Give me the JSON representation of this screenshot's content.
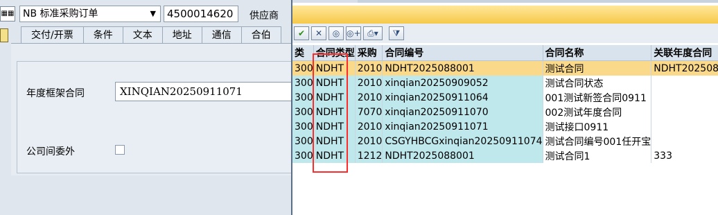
{
  "form": {
    "doc_type": "NB 标准采购订单",
    "po_number": "4500014620",
    "vendor_label": "供应商",
    "left_icon_text": "▦▦",
    "tabs": [
      "交付/开票",
      "条件",
      "文本",
      "地址",
      "通信",
      "合伯"
    ],
    "annual_contract_label": "年度框架合同",
    "annual_contract_value": "XINQIAN20250911071",
    "intercompany_label": "公司间委外"
  },
  "popup": {
    "toolbar_icons": [
      "check-icon",
      "cancel-icon",
      "binoculars-icon",
      "binoculars-plus-icon",
      "print-icon",
      "filter-icon"
    ],
    "columns": [
      "类",
      "合同类型",
      "采购",
      "合同编号",
      "合同名称",
      "关联年度合同"
    ],
    "rows": [
      [
        "300",
        "NDHT",
        "2010",
        "NDHT2025088001",
        "测试合同",
        "NDHT202508"
      ],
      [
        "300",
        "NDHT",
        "2010",
        "xinqian20250909052",
        "测试合同状态",
        ""
      ],
      [
        "300",
        "NDHT",
        "2010",
        "xinqian20250911064",
        "001测试新签合同0911",
        ""
      ],
      [
        "300",
        "NDHT",
        "7070",
        "xinqian20250911070",
        "002测试年度合同",
        ""
      ],
      [
        "300",
        "NDHT",
        "2010",
        "xinqian20250911071",
        "测试接口0911",
        ""
      ],
      [
        "300",
        "NDHT",
        "2010",
        "CSGYHBCGxinqian20250911074",
        "测试合同编号001任开宝",
        ""
      ],
      [
        "300",
        "NDHT",
        "1212",
        "NDHT2025088001",
        "测试合同1",
        "333"
      ]
    ],
    "selected_row": 0
  }
}
